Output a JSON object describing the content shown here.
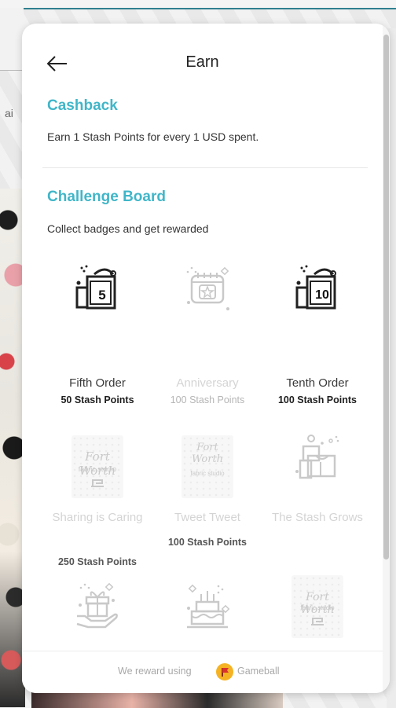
{
  "header": {
    "title": "Earn"
  },
  "cashback": {
    "title": "Cashback",
    "description": "Earn 1 Stash Points for every 1 USD spent."
  },
  "challenge_board": {
    "title": "Challenge Board",
    "description": "Collect badges and get rewarded",
    "badges": [
      {
        "name": "Fifth Order",
        "points": "50 Stash Points",
        "icon": "shopping-bag-5-icon",
        "locked": false,
        "number": "5"
      },
      {
        "name": "Anniversary",
        "points": "100 Stash Points",
        "icon": "calendar-star-icon",
        "locked": true
      },
      {
        "name": "Tenth Order",
        "points": "100 Stash Points",
        "icon": "shopping-bag-10-icon",
        "locked": false,
        "number": "10"
      },
      {
        "name": "Sharing is Caring",
        "points": "250 Stash Points",
        "icon": "fort-worth-logo-icon",
        "locked": true
      },
      {
        "name": "Tweet Tweet",
        "points": "100 Stash Points",
        "icon": "fort-worth-logo-icon",
        "locked": true
      },
      {
        "name": "The Stash Grows",
        "points": "",
        "icon": "shopping-bags-icon",
        "locked": true
      },
      {
        "name": "",
        "points": "",
        "icon": "gift-hand-icon",
        "locked": true
      },
      {
        "name": "",
        "points": "",
        "icon": "birthday-cake-icon",
        "locked": true
      },
      {
        "name": "",
        "points": "",
        "icon": "fort-worth-logo-icon",
        "locked": true
      }
    ],
    "studio_logo": {
      "line1": "Fort Worth",
      "line2": "fabric studio"
    }
  },
  "footer": {
    "prefix": "We reward using",
    "brand": "Gameball"
  },
  "background": {
    "partial_text": "ai"
  },
  "colors": {
    "accent": "#40b6c8",
    "locked": "#d4d4d4",
    "gameball": "#f5b324"
  }
}
